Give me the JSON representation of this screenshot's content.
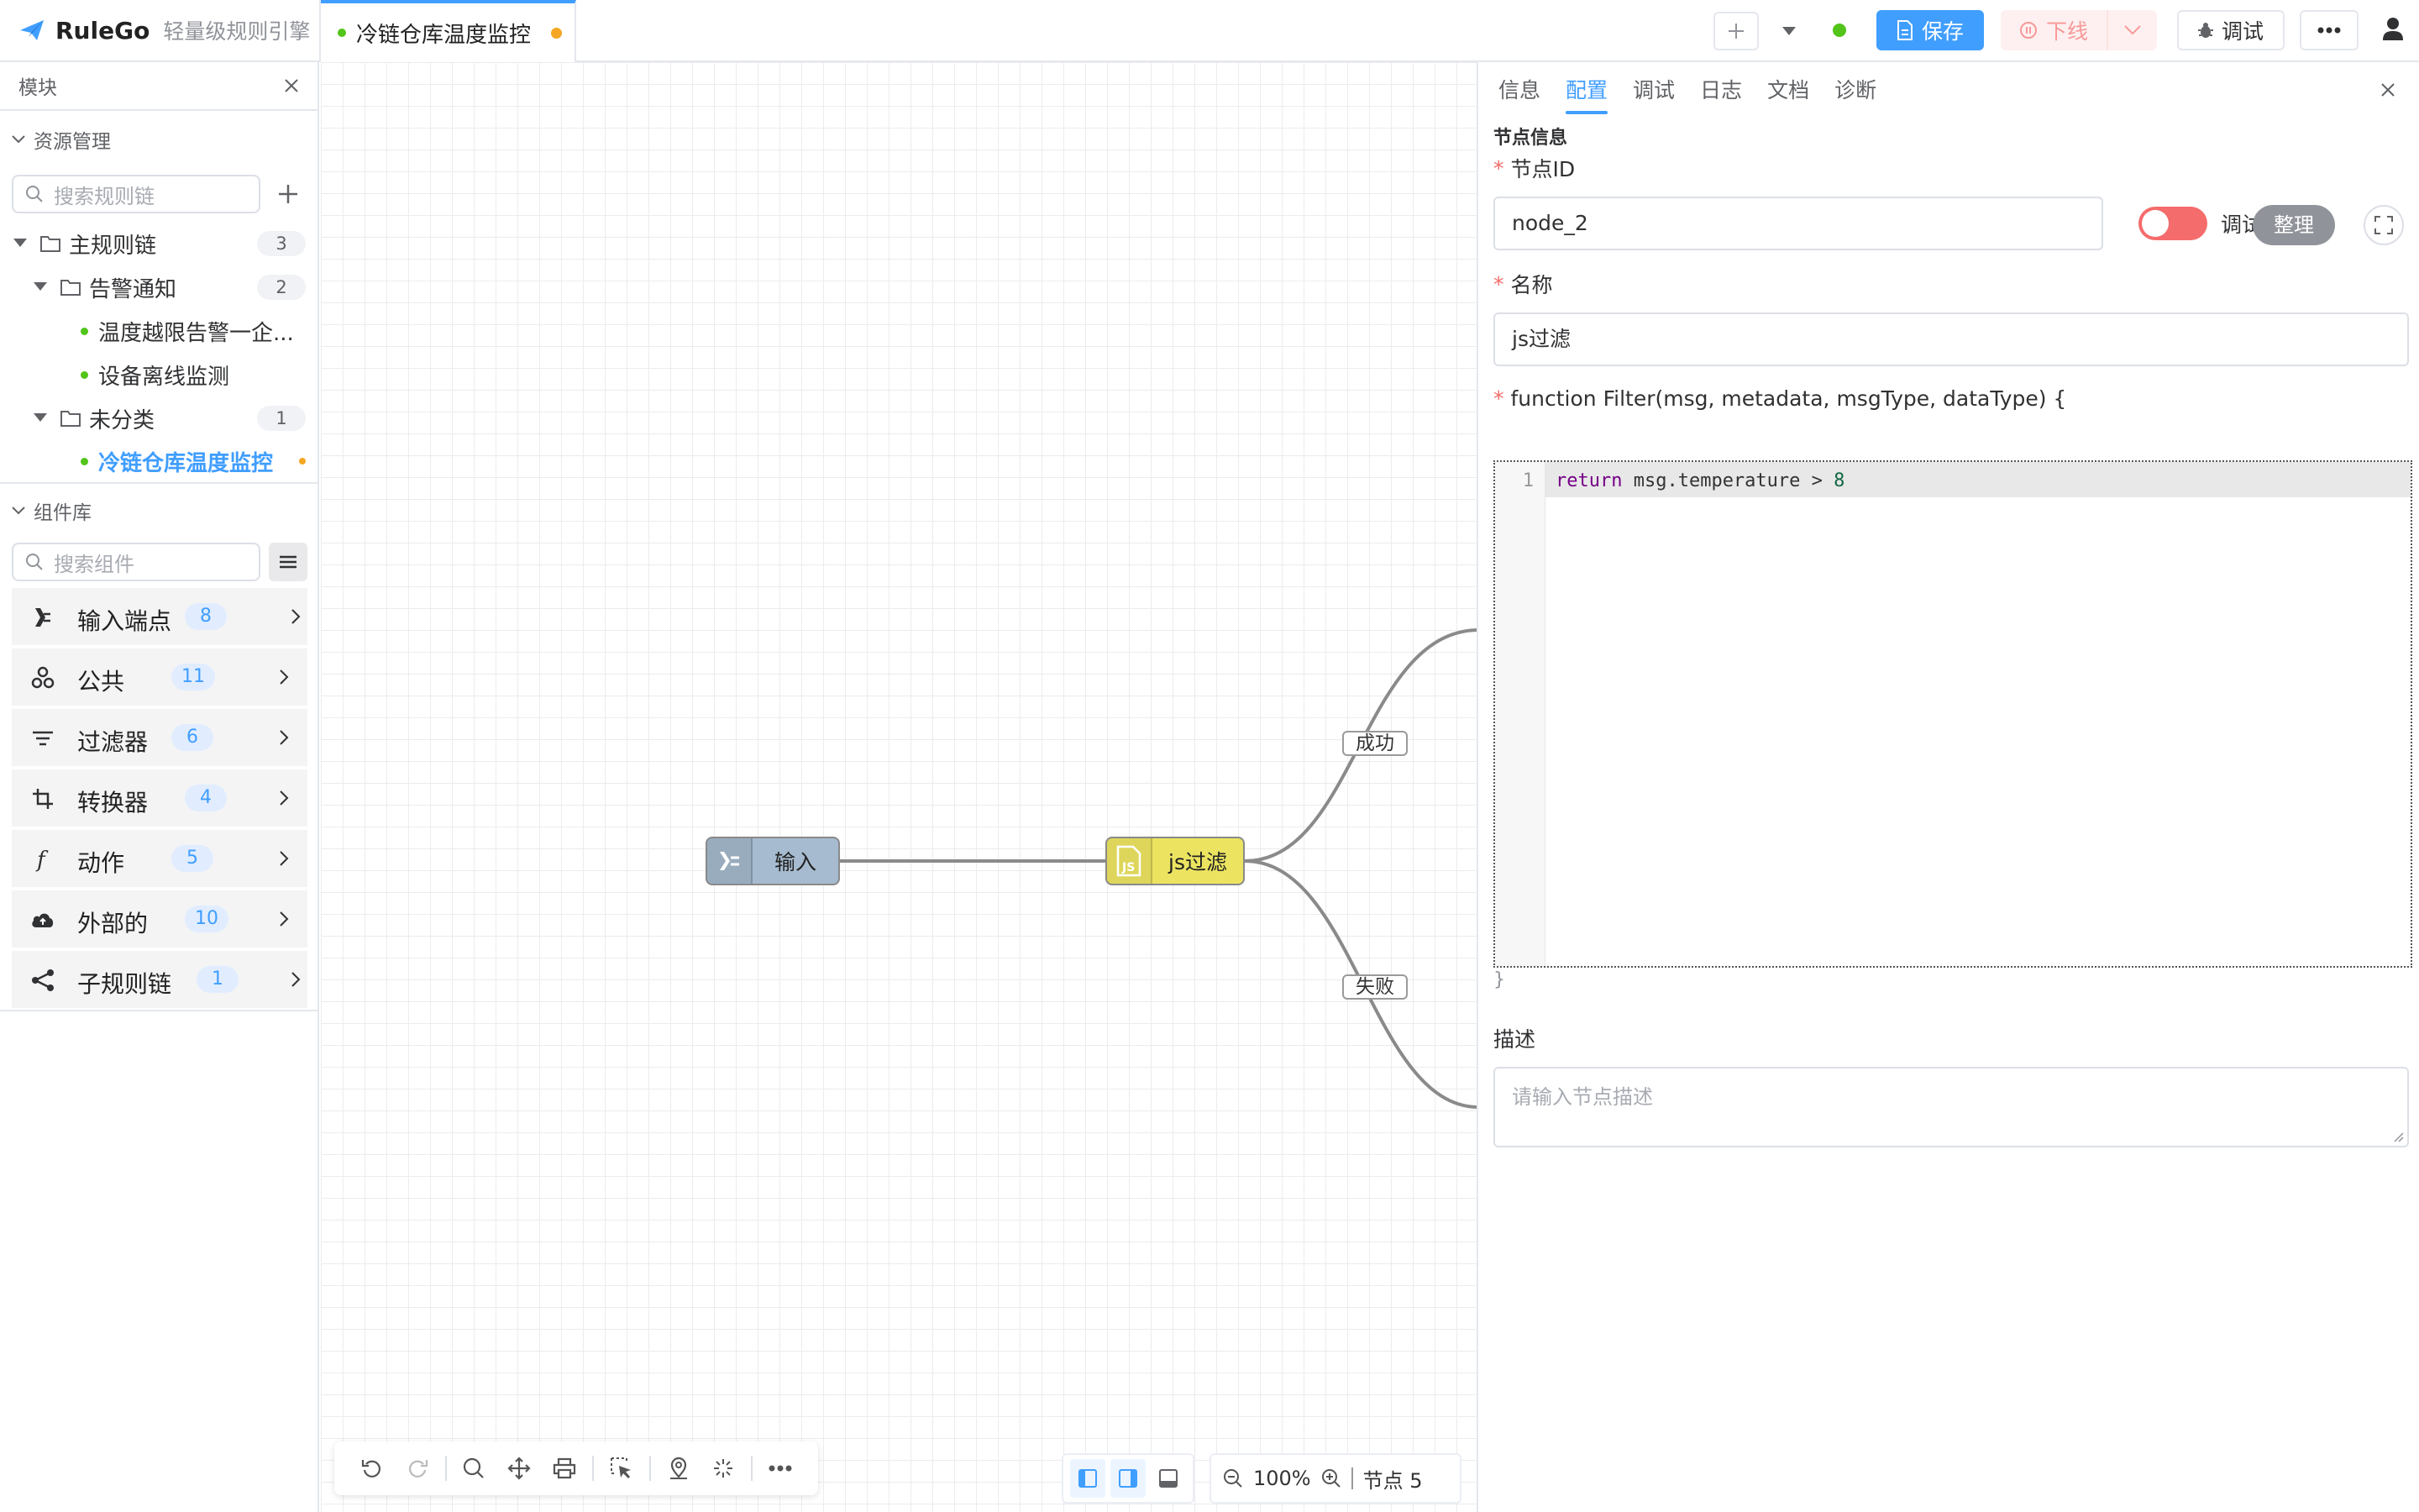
{
  "app": {
    "brand": "RuleGo",
    "tagline": "轻量级规则引擎"
  },
  "tab": {
    "title": "冷链仓库温度监控"
  },
  "toolbar": {
    "save_label": "保存",
    "offline_label": "下线",
    "debug_label": "调试"
  },
  "sidebar": {
    "title": "模块",
    "resource_section": "资源管理",
    "search_chain_placeholder": "搜索规则链",
    "tree": {
      "main": {
        "label": "主规则链",
        "count": "3"
      },
      "alarm": {
        "label": "告警通知",
        "count": "2"
      },
      "alarm_items": [
        "温度越限告警一企...",
        "设备离线监测"
      ],
      "uncat": {
        "label": "未分类",
        "count": "1"
      },
      "uncat_items": [
        "冷链仓库温度监控"
      ]
    },
    "component_section": "组件库",
    "search_component_placeholder": "搜索组件",
    "components": [
      {
        "label": "输入端点",
        "count": "8",
        "icon": "input-endpoint-icon"
      },
      {
        "label": "公共",
        "count": "11",
        "icon": "common-icon"
      },
      {
        "label": "过滤器",
        "count": "6",
        "icon": "filter-icon"
      },
      {
        "label": "转换器",
        "count": "4",
        "icon": "transform-icon"
      },
      {
        "label": "动作",
        "count": "5",
        "icon": "function-icon"
      },
      {
        "label": "外部的",
        "count": "10",
        "icon": "cloud-upload-icon"
      },
      {
        "label": "子规则链",
        "count": "1",
        "icon": "share-icon"
      }
    ]
  },
  "canvas": {
    "nodes": [
      {
        "label": "输入",
        "color": "#a6bbcf"
      },
      {
        "label": "js过滤",
        "color": "#ece460"
      }
    ],
    "edges": [
      "成功",
      "失败"
    ],
    "zoom": "100%",
    "node_count": "节点 5"
  },
  "panel": {
    "tabs": [
      "信息",
      "配置",
      "调试",
      "日志",
      "文档",
      "诊断"
    ],
    "active_tab": "配置",
    "section_title": "节点信息",
    "node_id_label": "节点ID",
    "node_id_value": "node_2",
    "debug_mode_label": "调试模式",
    "name_label": "名称",
    "name_value": "js过滤",
    "function_signature": "function Filter(msg, metadata, msgType, dataType) {",
    "format_label": "整理",
    "code_line_number": "1",
    "code_keyword": "return",
    "code_expr": " msg.temperature > ",
    "code_number": "8",
    "closing_brace": "}",
    "description_label": "描述",
    "description_placeholder": "请输入节点描述"
  }
}
